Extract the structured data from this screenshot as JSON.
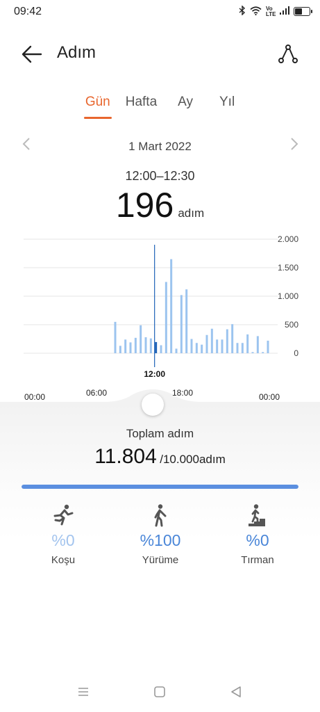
{
  "status_bar": {
    "time": "09:42",
    "network_label": "Vo LTE",
    "battery_level": 0.55
  },
  "header": {
    "title": "Adım",
    "back_icon": "arrow-left-icon",
    "route_icon": "route-icon"
  },
  "tabs": [
    {
      "label": "Gün",
      "active": true
    },
    {
      "label": "Hafta",
      "active": false
    },
    {
      "label": "Ay",
      "active": false
    },
    {
      "label": "Yıl",
      "active": false
    }
  ],
  "date": {
    "label": "1 Mart 2022"
  },
  "selection": {
    "range": "12:00–12:30",
    "value": "196",
    "unit": "adım",
    "cursor_label": "12:00"
  },
  "chart_data": {
    "type": "bar",
    "x_unit": "hour",
    "x_range": [
      0,
      24
    ],
    "ylim": [
      0,
      2000
    ],
    "y_ticks": [
      "2.000",
      "1.500",
      "1.000",
      "500",
      "0"
    ],
    "y_tick_values": [
      2000,
      1500,
      1000,
      500,
      0
    ],
    "x_tick_labels": [
      "00:00",
      "06:00",
      "18:00",
      "00:00"
    ],
    "x_tick_hours": [
      0,
      6,
      18,
      24
    ],
    "bars": [
      {
        "x": 9.0,
        "y": 550
      },
      {
        "x": 9.5,
        "y": 130
      },
      {
        "x": 10.0,
        "y": 240
      },
      {
        "x": 10.5,
        "y": 190
      },
      {
        "x": 11.0,
        "y": 270
      },
      {
        "x": 11.5,
        "y": 490
      },
      {
        "x": 12.0,
        "y": 280
      },
      {
        "x": 12.5,
        "y": 260
      },
      {
        "x": 13.0,
        "y": 196,
        "selected": true
      },
      {
        "x": 13.5,
        "y": 140
      },
      {
        "x": 14.0,
        "y": 1250
      },
      {
        "x": 14.5,
        "y": 1650
      },
      {
        "x": 15.0,
        "y": 80
      },
      {
        "x": 15.5,
        "y": 1020
      },
      {
        "x": 16.0,
        "y": 1120
      },
      {
        "x": 16.5,
        "y": 250
      },
      {
        "x": 17.0,
        "y": 180
      },
      {
        "x": 17.5,
        "y": 150
      },
      {
        "x": 18.0,
        "y": 320
      },
      {
        "x": 18.5,
        "y": 430
      },
      {
        "x": 19.0,
        "y": 240
      },
      {
        "x": 19.5,
        "y": 240
      },
      {
        "x": 20.0,
        "y": 420
      },
      {
        "x": 20.5,
        "y": 510
      },
      {
        "x": 21.0,
        "y": 180
      },
      {
        "x": 21.5,
        "y": 180
      },
      {
        "x": 22.0,
        "y": 330
      },
      {
        "x": 22.5,
        "y": 20
      },
      {
        "x": 23.0,
        "y": 300
      },
      {
        "x": 23.5,
        "y": 20
      },
      {
        "x": 24.0,
        "y": 220
      }
    ],
    "colors": {
      "bar": "#9cc4ef",
      "selected": "#1e63b8",
      "grid": "#e4e4e4"
    }
  },
  "summary": {
    "label": "Toplam adım",
    "value": "11.804",
    "goal": "/10.000adım",
    "progress": 1.0
  },
  "activities": [
    {
      "icon": "running-icon",
      "pct": "%0",
      "label": "Koşu",
      "color": "#a3c4ee"
    },
    {
      "icon": "walking-icon",
      "pct": "%100",
      "label": "Yürüme",
      "color": "#4a86d8"
    },
    {
      "icon": "stairs-climbing-icon",
      "pct": "%0",
      "label": "Tırman",
      "color": "#4a86d8"
    }
  ],
  "nav_bar": {
    "menu_icon": "menu-icon",
    "home_icon": "home-icon",
    "back_icon": "back-triangle-icon"
  }
}
